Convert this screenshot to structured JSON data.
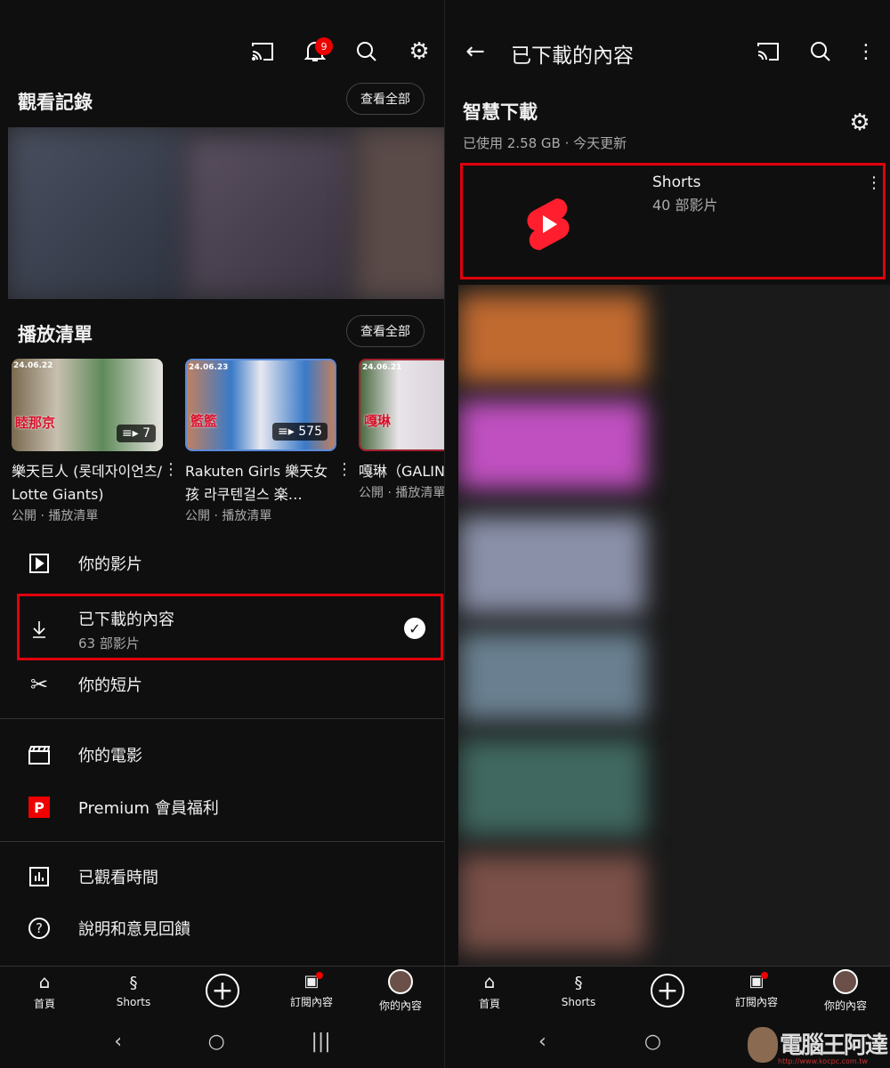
{
  "left": {
    "history": {
      "title": "觀看記錄",
      "view_all": "查看全部"
    },
    "notifications_count": "9",
    "playlists": {
      "title": "播放清單",
      "view_all": "查看全部",
      "items": [
        {
          "title": "樂天巨人 (롯데자이언츠/ Lotte Giants)",
          "meta": "公開 · 播放清單",
          "count": "7",
          "date": "24.06.22",
          "tag": "睦那京"
        },
        {
          "title": "Rakuten Girls 樂天女孩 라쿠텐걸스 楽…",
          "meta": "公開 · 播放清單",
          "count": "575",
          "date": "24.06.23",
          "tag": "籃籃"
        },
        {
          "title": "嘎琳（GALIN",
          "meta": "公開 · 播放清單",
          "date": "24.06.21",
          "tag": "嘎琳"
        }
      ]
    },
    "menu": [
      {
        "label": "你的影片",
        "icon": "play-square-icon"
      },
      {
        "label": "已下載的內容",
        "sub": "63 部影片",
        "icon": "download-icon"
      },
      {
        "label": "你的短片",
        "icon": "scissors-icon"
      },
      {
        "label": "你的電影",
        "icon": "clapperboard-icon"
      },
      {
        "label": "Premium 會員福利",
        "icon": "premium-icon",
        "premium_letter": "P"
      },
      {
        "label": "已觀看時間",
        "icon": "bar-chart-icon"
      },
      {
        "label": "說明和意見回饋",
        "icon": "help-icon"
      }
    ]
  },
  "right": {
    "title": "已下載的內容",
    "smart": {
      "title": "智慧下載",
      "usage": "已使用 2.58 GB · 今天更新"
    },
    "shorts": {
      "title": "Shorts",
      "count": "40 部影片"
    }
  },
  "nav": [
    {
      "label": "首頁"
    },
    {
      "label": "Shorts"
    },
    {
      "label": ""
    },
    {
      "label": "訂閱內容"
    },
    {
      "label": "你的內容"
    }
  ],
  "watermark": {
    "text": "電腦王阿達",
    "url": "http://www.kocpc.com.tw"
  },
  "colors": {
    "accent": "#e0000c",
    "bg": "#0f0f0f"
  }
}
